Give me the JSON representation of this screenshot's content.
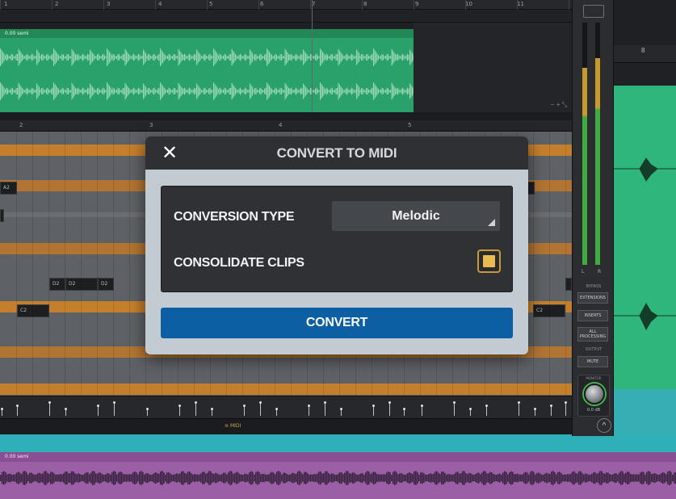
{
  "dialog": {
    "title": "CONVERT TO MIDI",
    "close_icon": "close-icon",
    "conversion_type_label": "CONVERSION TYPE",
    "conversion_type_value": "Melodic",
    "consolidate_label": "CONSOLIDATE CLIPS",
    "consolidate_checked": true,
    "convert_button": "CONVERT",
    "colors": {
      "primary": "#0c5fa3",
      "checkbox": "#e9bc52"
    }
  },
  "timeline": {
    "top_ruler_numbers": [
      "1",
      "2",
      "3",
      "4",
      "5",
      "6",
      "7",
      "8",
      "9",
      "10",
      "11"
    ],
    "mid_ruler_numbers": [
      "2",
      "3",
      "4",
      "5"
    ],
    "right_ruler_number": "8"
  },
  "clips": {
    "green_clip_label": "0.00 semi",
    "purple_clip_label": "0.00 semi"
  },
  "piano_notes": {
    "a2": "A2",
    "d2a": "D2",
    "d2b": "D2",
    "d2c": "D2",
    "c2a": "C2",
    "c2b": "C2"
  },
  "bottom_bar": {
    "midi_label": "MIDI"
  },
  "channel_panel": {
    "meter_left": "L",
    "meter_right": "R",
    "bypass_label": "BYPASS",
    "extensions_button": "EXTENSIONS",
    "inserts_button": "INSERTS",
    "all_processing_button": "ALL PROCESSING",
    "output_label": "OUTPUT",
    "mute_button": "MUTE",
    "monitor_label": "MONITOR",
    "monitor_value": "0.0 dB"
  }
}
